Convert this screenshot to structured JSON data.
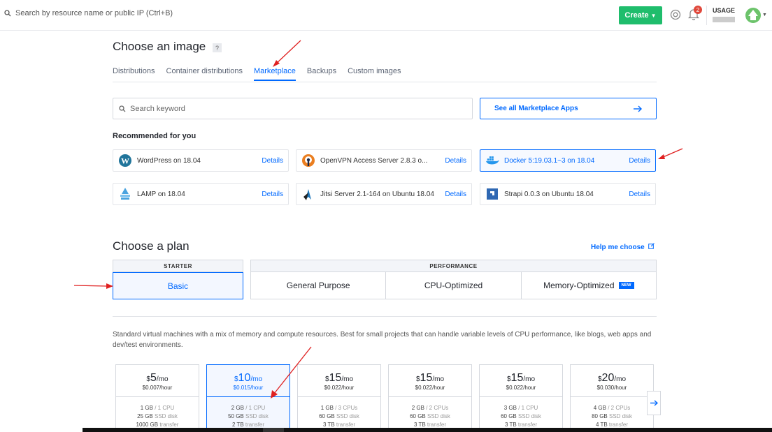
{
  "header": {
    "search_placeholder": "Search by resource name or public IP (Ctrl+B)",
    "create_label": "Create",
    "notif_count": "2",
    "usage_label": "USAGE"
  },
  "image": {
    "title": "Choose an image",
    "help": "?",
    "tabs": [
      "Distributions",
      "Container distributions",
      "Marketplace",
      "Backups",
      "Custom images"
    ],
    "active_tab": "Marketplace",
    "keyword_placeholder": "Search keyword",
    "see_all": "See all Marketplace Apps",
    "recommended_title": "Recommended for you",
    "apps": [
      {
        "name": "WordPress on 18.04",
        "details": "Details"
      },
      {
        "name": "OpenVPN Access Server 2.8.3 o...",
        "details": "Details"
      },
      {
        "name": "Docker 5:19.03.1~3 on 18.04",
        "details": "Details"
      },
      {
        "name": "LAMP on 18.04",
        "details": "Details"
      },
      {
        "name": "Jitsi Server 2.1-164 on Ubuntu 18.04",
        "details": "Details"
      },
      {
        "name": "Strapi 0.0.3 on Ubuntu 18.04",
        "details": "Details"
      }
    ]
  },
  "plan": {
    "title": "Choose a plan",
    "help_me": "Help me choose",
    "starter": "STARTER",
    "performance": "PERFORMANCE",
    "basic": "Basic",
    "general": "General Purpose",
    "cpu": "CPU-Optimized",
    "memory": "Memory-Optimized",
    "new_badge": "NEW",
    "description": "Standard virtual machines with a mix of memory and compute resources. Best for small projects that can handle variable levels of CPU performance, like blogs, web apps and dev/test environments.",
    "prices": [
      {
        "dollar": "$",
        "amount": "5",
        "per": "/mo",
        "hourly": "$0.007/hour",
        "mem": "1 GB",
        "cpu": "/ 1 CPU",
        "disk": "25 GB",
        "disk_unit": "SSD disk",
        "transfer": "1000 GB",
        "transfer_unit": "transfer"
      },
      {
        "dollar": "$",
        "amount": "10",
        "per": "/mo",
        "hourly": "$0.015/hour",
        "mem": "2 GB",
        "cpu": "/ 1 CPU",
        "disk": "50 GB",
        "disk_unit": "SSD disk",
        "transfer": "2 TB",
        "transfer_unit": "transfer"
      },
      {
        "dollar": "$",
        "amount": "15",
        "per": "/mo",
        "hourly": "$0.022/hour",
        "mem": "1 GB",
        "cpu": "/ 3 CPUs",
        "disk": "60 GB",
        "disk_unit": "SSD disk",
        "transfer": "3 TB",
        "transfer_unit": "transfer"
      },
      {
        "dollar": "$",
        "amount": "15",
        "per": "/mo",
        "hourly": "$0.022/hour",
        "mem": "2 GB",
        "cpu": "/ 2 CPUs",
        "disk": "60 GB",
        "disk_unit": "SSD disk",
        "transfer": "3 TB",
        "transfer_unit": "transfer"
      },
      {
        "dollar": "$",
        "amount": "15",
        "per": "/mo",
        "hourly": "$0.022/hour",
        "mem": "3 GB",
        "cpu": "/ 1 CPU",
        "disk": "60 GB",
        "disk_unit": "SSD disk",
        "transfer": "3 TB",
        "transfer_unit": "transfer"
      },
      {
        "dollar": "$",
        "amount": "20",
        "per": "/mo",
        "hourly": "$0.030/hour",
        "mem": "4 GB",
        "cpu": "/ 2 CPUs",
        "disk": "80 GB",
        "disk_unit": "SSD disk",
        "transfer": "4 TB",
        "transfer_unit": "transfer"
      }
    ]
  },
  "colors": {
    "accent": "#0069ff",
    "create": "#1fbd6c",
    "annotation": "#e02020"
  }
}
